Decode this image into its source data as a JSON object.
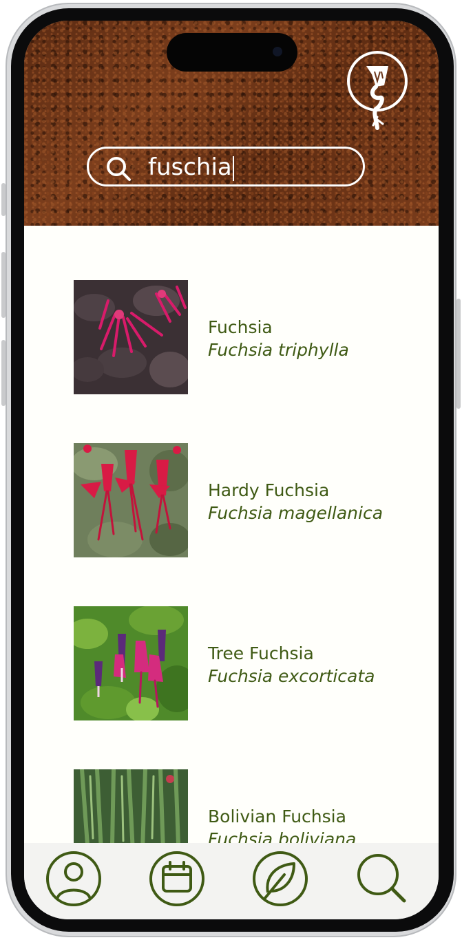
{
  "search": {
    "value": "fuschia"
  },
  "icons": {
    "logo": "plant-logo-icon",
    "search": "search-icon",
    "nav": [
      "profile-icon",
      "calendar-icon",
      "leaf-icon",
      "search-icon"
    ]
  },
  "results": [
    {
      "common": "Fuchsia",
      "latin": "Fuchsia triphylla",
      "image": "fuchsia-triphylla-photo"
    },
    {
      "common": "Hardy Fuchsia",
      "latin": "Fuchsia magellanica",
      "image": "fuchsia-magellanica-photo"
    },
    {
      "common": "Tree Fuchsia",
      "latin": "Fuchsia excorticata",
      "image": "fuchsia-excorticata-photo"
    },
    {
      "common": "Bolivian Fuchsia",
      "latin": "Fuchsia boliviana",
      "image": "fuchsia-boliviana-photo"
    }
  ],
  "colors": {
    "accent": "#3f5a14",
    "soil": "#6b3418",
    "screen_bg": "#fffffb",
    "navbar_bg": "#f3f3f1"
  }
}
